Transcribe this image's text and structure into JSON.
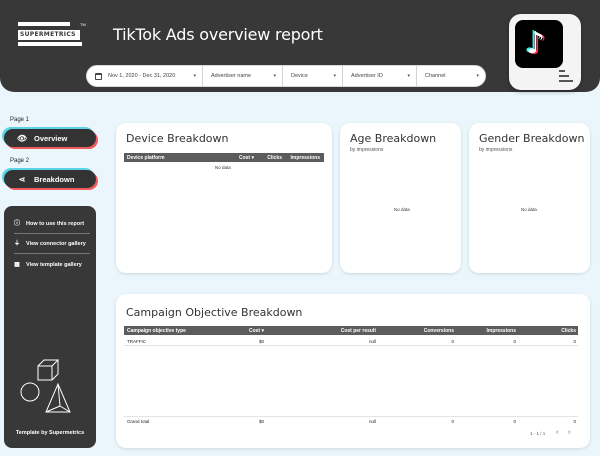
{
  "header": {
    "logo_text": "SUPERMETRICS",
    "logo_tm": "TM",
    "title": "TikTok Ads overview report",
    "filters": [
      {
        "label": "Nov 1, 2020 - Dec 31, 2020",
        "icon": "calendar-icon"
      },
      {
        "label": "Advertiser name"
      },
      {
        "label": "Device"
      },
      {
        "label": "Advertiser ID"
      },
      {
        "label": "Channel"
      }
    ],
    "caret": "▾",
    "tiktok_glyph": "♪"
  },
  "nav": {
    "page1_label": "Page 1",
    "page1_button": "Overview",
    "page2_label": "Page 2",
    "page2_button": "Breakdown"
  },
  "side": {
    "links": [
      {
        "label": "How to use this report",
        "icon": "info-icon"
      },
      {
        "label": "View connector gallery",
        "icon": "plug-icon"
      },
      {
        "label": "View template gallery",
        "icon": "grid-icon"
      }
    ],
    "footer": "Template by Supermetrics"
  },
  "device_breakdown": {
    "title": "Device Breakdown",
    "columns": [
      "Device platform",
      "Cost ▾",
      "Clicks",
      "Impressions"
    ],
    "empty": "No data"
  },
  "age_breakdown": {
    "title": "Age Breakdown",
    "subtitle": "by impressions",
    "empty": "No data"
  },
  "gender_breakdown": {
    "title": "Gender Breakdown",
    "subtitle": "by impressions",
    "empty": "No data"
  },
  "campaign_breakdown": {
    "title": "Campaign Objective Breakdown",
    "columns": [
      "Campaign objective type",
      "Cost ▾",
      "Cost per result",
      "Conversions",
      "Impressions",
      "Clicks"
    ],
    "rows": [
      [
        "TRAFFIC",
        "$0",
        "null",
        "0",
        "0",
        "0"
      ]
    ],
    "total": [
      "Grand total",
      "$0",
      "null",
      "0",
      "0",
      "0"
    ],
    "pager": "1 - 1 / 1",
    "prev": "‹",
    "next": "›"
  },
  "colors": {
    "header_bg": "#383838",
    "page_bg": "#eaf6fb",
    "accent_cyan": "#5ad2e8",
    "accent_red": "#f05a5a",
    "tiktok_cyan": "#25f4ee",
    "tiktok_red": "#fe2c55"
  }
}
